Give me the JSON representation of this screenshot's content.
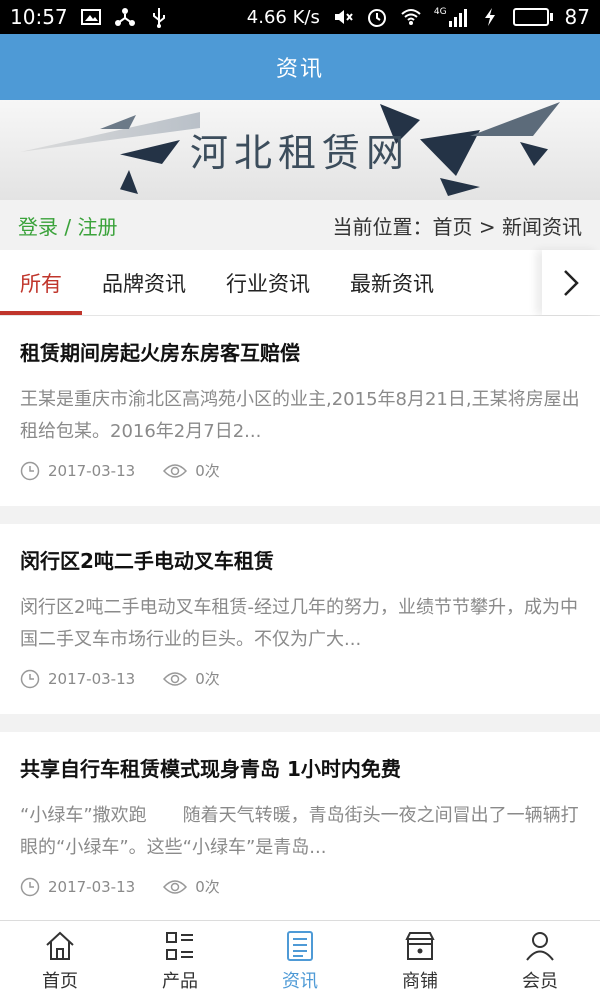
{
  "status_bar": {
    "time": "10:57",
    "speed": "4.66 K/s",
    "network": "4G",
    "battery": "87",
    "battery_level": 0.87
  },
  "header": {
    "title": "资讯"
  },
  "banner": {
    "site_title": "河北租赁网"
  },
  "location_row": {
    "login_label": "登录 / 注册",
    "location_text": "当前位置：首页 > 新闻资讯"
  },
  "tabs": [
    {
      "label": "所有",
      "active": true
    },
    {
      "label": "品牌资讯",
      "active": false
    },
    {
      "label": "行业资讯",
      "active": false
    },
    {
      "label": "最新资讯",
      "active": false
    }
  ],
  "articles": [
    {
      "title": "租赁期间房起火房东房客互赔偿",
      "summary": "王某是重庆市渝北区高鸿苑小区的业主,2015年8月21日,王某将房屋出租给包某。2016年2月7日2...",
      "date": "2017-03-13",
      "views": "0次"
    },
    {
      "title": "闵行区2吨二手电动叉车租赁",
      "summary": "闵行区2吨二手电动叉车租赁-经过几年的努力，业绩节节攀升，成为中国二手叉车市场行业的巨头。不仅为广大...",
      "date": "2017-03-13",
      "views": "0次"
    },
    {
      "title": "共享自行车租赁模式现身青岛 1小时内免费",
      "summary": "“小绿车”撒欢跑　　随着天气转暖，青岛街头一夜之间冒出了一辆辆打眼的“小绿车”。这些“小绿车”是青岛...",
      "date": "2017-03-13",
      "views": "0次"
    }
  ],
  "bottom_nav": [
    {
      "label": "首页",
      "icon": "home-icon",
      "active": false
    },
    {
      "label": "产品",
      "icon": "product-grid-icon",
      "active": false
    },
    {
      "label": "资讯",
      "icon": "news-icon",
      "active": true
    },
    {
      "label": "商铺",
      "icon": "shop-icon",
      "active": false
    },
    {
      "label": "会员",
      "icon": "user-icon",
      "active": false
    }
  ],
  "colors": {
    "header_blue": "#4e9ad6",
    "active_tab_red": "#c0352b",
    "login_green": "#3aa23a",
    "nav_active": "#4e9ad6"
  }
}
